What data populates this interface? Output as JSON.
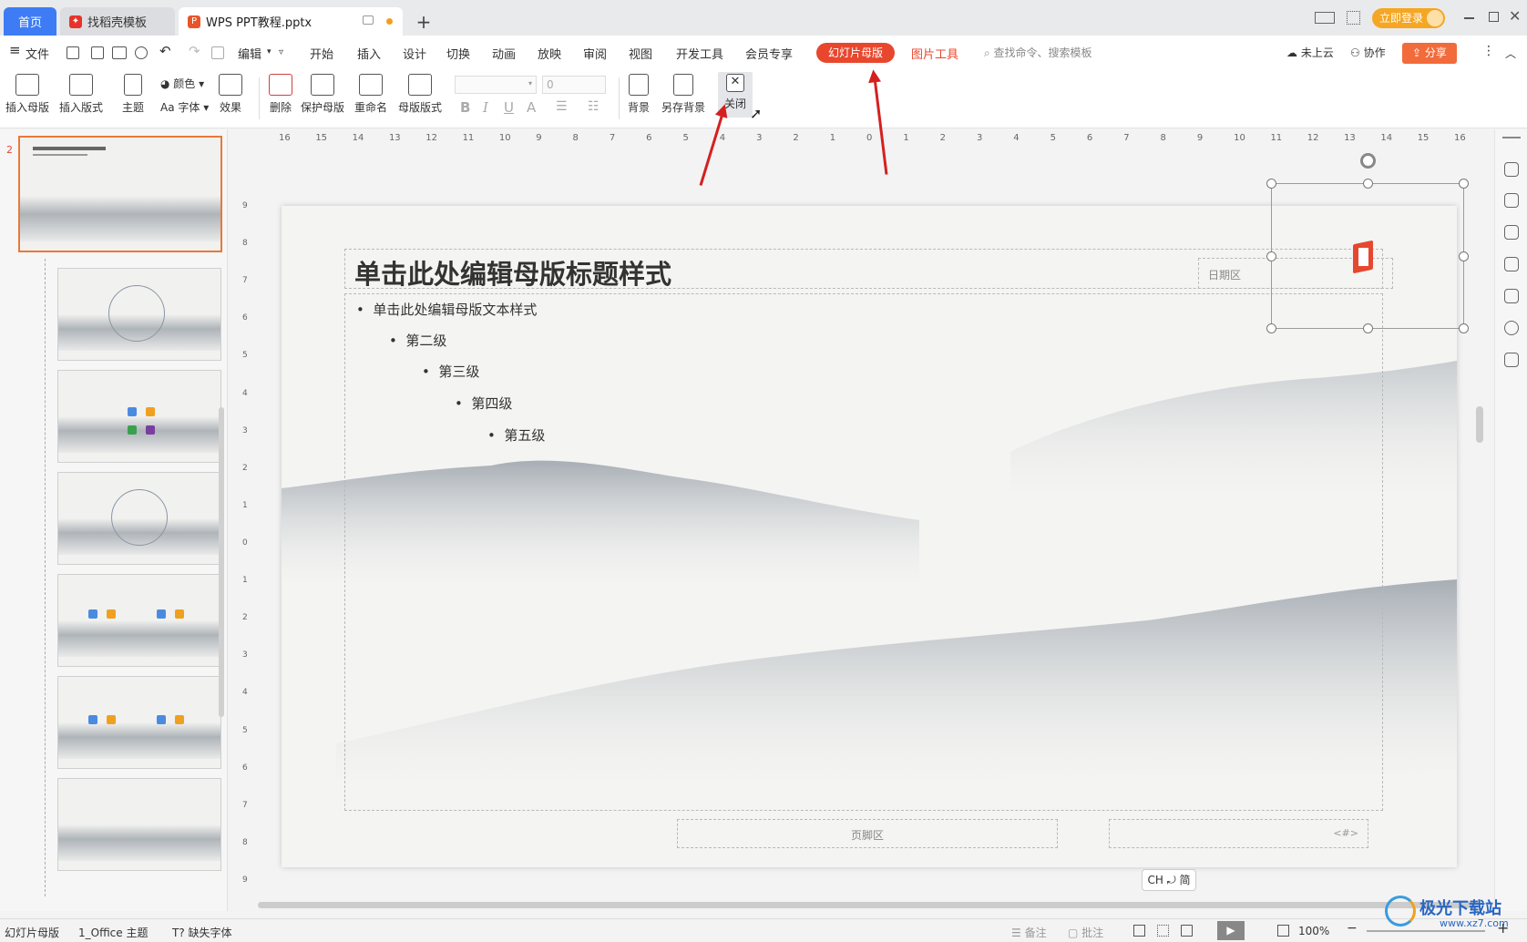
{
  "tabs": {
    "home": "首页",
    "template": "找稻壳模板",
    "file": "WPS PPT教程.pptx",
    "add": "+"
  },
  "titlebar": {
    "login": "立即登录"
  },
  "menu": {
    "file": "文件",
    "edit": "编辑",
    "items": [
      "开始",
      "插入",
      "设计",
      "切换",
      "动画",
      "放映",
      "审阅",
      "视图",
      "开发工具",
      "会员专享"
    ],
    "slide_master": "幻灯片母版",
    "picture_tools": "图片工具",
    "search": "查找命令、搜索模板",
    "cloud": "未上云",
    "collab": "协作",
    "share": "分享"
  },
  "ribbon": {
    "insert_master": "插入母版",
    "insert_layout": "插入版式",
    "theme": "主题",
    "color": "颜色",
    "font": "Aa 字体",
    "effect": "效果",
    "delete": "删除",
    "protect_master": "保护母版",
    "rename": "重命名",
    "master_layout": "母版版式",
    "font_size": "0",
    "background": "背景",
    "save_background": "另存背景",
    "close": "关闭"
  },
  "thumbnails": {
    "current_index": "2"
  },
  "slide": {
    "title": "单击此处编辑母版标题样式",
    "date": "日期区",
    "bullets": [
      "单击此处编辑母版文本样式",
      "第二级",
      "第三级",
      "第四级",
      "第五级"
    ],
    "footer": "页脚区",
    "page_number": "<#>"
  },
  "ruler": {
    "h_ticks": [
      "16",
      "15",
      "14",
      "13",
      "12",
      "11",
      "10",
      "9",
      "8",
      "7",
      "6",
      "5",
      "4",
      "3",
      "2",
      "1",
      "0",
      "1",
      "2",
      "3",
      "4",
      "5",
      "6",
      "7",
      "8",
      "9",
      "10",
      "11",
      "12",
      "13",
      "14",
      "15",
      "16"
    ],
    "v_ticks": [
      "9",
      "8",
      "7",
      "6",
      "5",
      "4",
      "3",
      "2",
      "1",
      "0",
      "1",
      "2",
      "3",
      "4",
      "5",
      "6",
      "7",
      "8",
      "9"
    ]
  },
  "ime": "CH ⤾ 简",
  "status": {
    "mode": "幻灯片母版",
    "theme": "1_Office 主题",
    "missing_font": "缺失字体",
    "notes": "备注",
    "comments": "批注",
    "zoom": "100%"
  },
  "watermark": "极光下载站",
  "watermark_url": "www.xz7.com",
  "colors": {
    "accent": "#3d7cf5",
    "master_tab": "#e8472e",
    "arrow": "#d42020"
  }
}
